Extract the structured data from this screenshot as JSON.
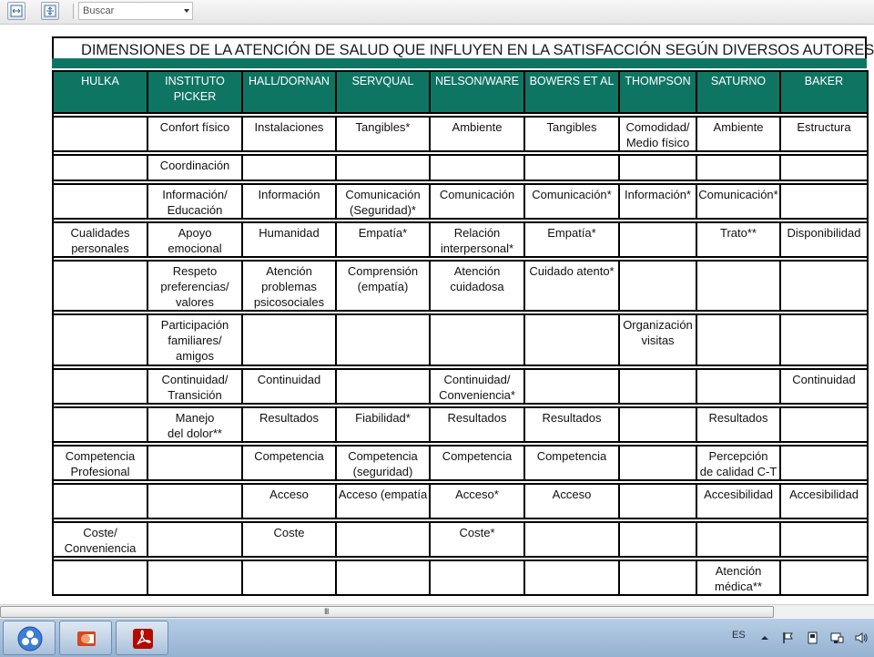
{
  "toolbar": {
    "search_placeholder": "Buscar"
  },
  "document": {
    "title": "DIMENSIONES DE LA ATENCIÓN DE SALUD QUE INFLUYEN EN LA SATISFACCIÓN SEGÚN DIVERSOS AUTORES",
    "accent_color": "#0f7563",
    "columns": [
      "HULKA",
      "INSTITUTO\nPICKER",
      "HALL/DORNAN",
      "SERVQUAL",
      "NELSON/WARE",
      "BOWERS ET AL",
      "THOMPSON",
      "SATURNO",
      "BAKER"
    ],
    "rows": [
      [
        "",
        "Confort físico",
        "Instalaciones",
        "Tangibles*",
        "Ambiente",
        "Tangibles",
        "Comodidad/\nMedio físico",
        "Ambiente",
        "Estructura"
      ],
      [
        "",
        "Coordinación",
        "",
        "",
        "",
        "",
        "",
        "",
        ""
      ],
      [
        "",
        "Información/\nEducación",
        "Información",
        "Comunicación\n(Seguridad)*",
        "Comunicación",
        "Comunicación*",
        "Información*",
        "Comunicación*",
        ""
      ],
      [
        "Cualidades\npersonales",
        "Apoyo\nemocional",
        "Humanidad",
        "Empatía*",
        "Relación\ninterpersonal*",
        "Empatía*",
        "",
        "Trato**",
        "Disponibilidad"
      ],
      [
        "",
        "Respeto\npreferencias/\nvalores",
        "Atención\nproblemas\npsicosociales",
        "Comprensión\n(empatía)",
        "Atención\ncuidadosa",
        "Cuidado atento*",
        "",
        "",
        ""
      ],
      [
        "",
        "Participación\nfamiliares/\namigos",
        "",
        "",
        "",
        "",
        "Organización\nvisitas",
        "",
        ""
      ],
      [
        "",
        "Continuidad/\nTransición",
        "Continuidad",
        "",
        "Continuidad/\nConveniencia*",
        "",
        "",
        "",
        "Continuidad"
      ],
      [
        "",
        "Manejo\ndel dolor**",
        "Resultados",
        "Fiabilidad*",
        "Resultados",
        "Resultados",
        "",
        "Resultados",
        ""
      ],
      [
        "Competencia\nProfesional",
        "",
        "Competencia",
        "Competencia\n(seguridad)",
        "Competencia",
        "Competencia",
        "",
        "Percepción\nde calidad C-T",
        ""
      ],
      [
        "",
        "",
        "Acceso",
        "Acceso (empatía",
        "Acceso*",
        "Acceso",
        "",
        "Accesibilidad",
        "Accesibilidad"
      ],
      [
        "Coste/\nConveniencia",
        "",
        "Coste",
        "",
        "Coste*",
        "",
        "",
        "",
        ""
      ],
      [
        "",
        "",
        "",
        "",
        "",
        "",
        "",
        "Atención\nmédica**",
        ""
      ]
    ]
  },
  "scrollbar": {
    "grip": "III"
  },
  "taskbar": {
    "language": "ES",
    "apps": [
      "app-launcher",
      "powerpoint",
      "acrobat-reader"
    ],
    "tray_icons": [
      "show-hidden-icons-arrow",
      "flag-icon",
      "device-icon",
      "network-icon",
      "volume-icon"
    ]
  }
}
